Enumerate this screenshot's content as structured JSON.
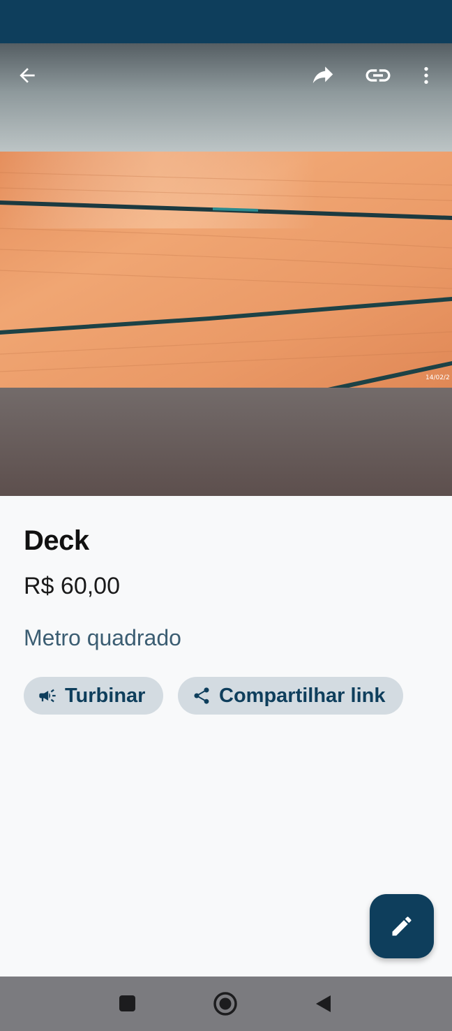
{
  "colors": {
    "primary": "#0e3e5c",
    "chip_background": "#d3dbe1",
    "secondary_text": "#3b5d72",
    "wood": "#e89866",
    "nav_bar": "#7b7b7f"
  },
  "toolbar": {
    "back_icon": "arrow-left-icon",
    "share_icon": "forward-share-icon",
    "link_icon": "link-icon",
    "more_icon": "more-vert-icon"
  },
  "photo": {
    "subject": "wood-deck-photo",
    "date_stamp": "14/02/2"
  },
  "product": {
    "title": "Deck",
    "price": "R$ 60,00",
    "unit": "Metro quadrado"
  },
  "actions": {
    "boost_label": "Turbinar",
    "boost_icon": "megaphone-icon",
    "share_link_label": "Compartilhar link",
    "share_link_icon": "share-icon"
  },
  "fab": {
    "icon": "edit-pencil-icon"
  },
  "navigation": {
    "recents_icon": "square-icon",
    "home_icon": "circle-icon",
    "back_icon": "triangle-back-icon"
  }
}
